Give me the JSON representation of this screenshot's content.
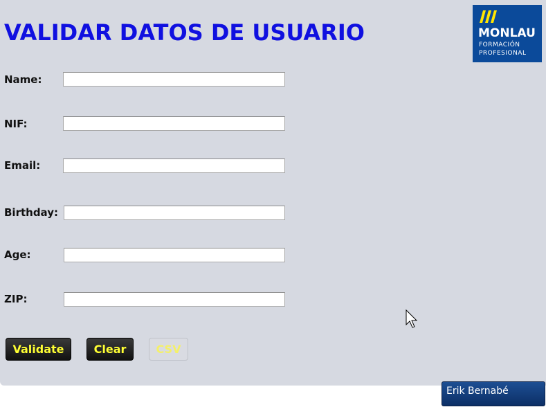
{
  "header": {
    "title": "VALIDAR DATOS DE USUARIO"
  },
  "logo": {
    "name": "MONLAU",
    "line1": "FORMACIÓN",
    "line2": "PROFESIONAL"
  },
  "form": {
    "name_label": "Name:",
    "nif_label": "NIF:",
    "email_label": "Email:",
    "birthday_label": "Birthday:",
    "age_label": "Age:",
    "zip_label": "ZIP:",
    "name_value": "",
    "nif_value": "",
    "email_value": "",
    "birthday_value": "",
    "age_value": "",
    "zip_value": ""
  },
  "buttons": {
    "validate": "Validate",
    "clear": "Clear",
    "csv": "CSV"
  },
  "tooltip": {
    "text": "Erik Bernabé"
  },
  "colors": {
    "panel_bg": "#d6d9e1",
    "title": "#1010e0",
    "button_text": "#ffff33",
    "logo_bg": "#0b4a9a"
  }
}
